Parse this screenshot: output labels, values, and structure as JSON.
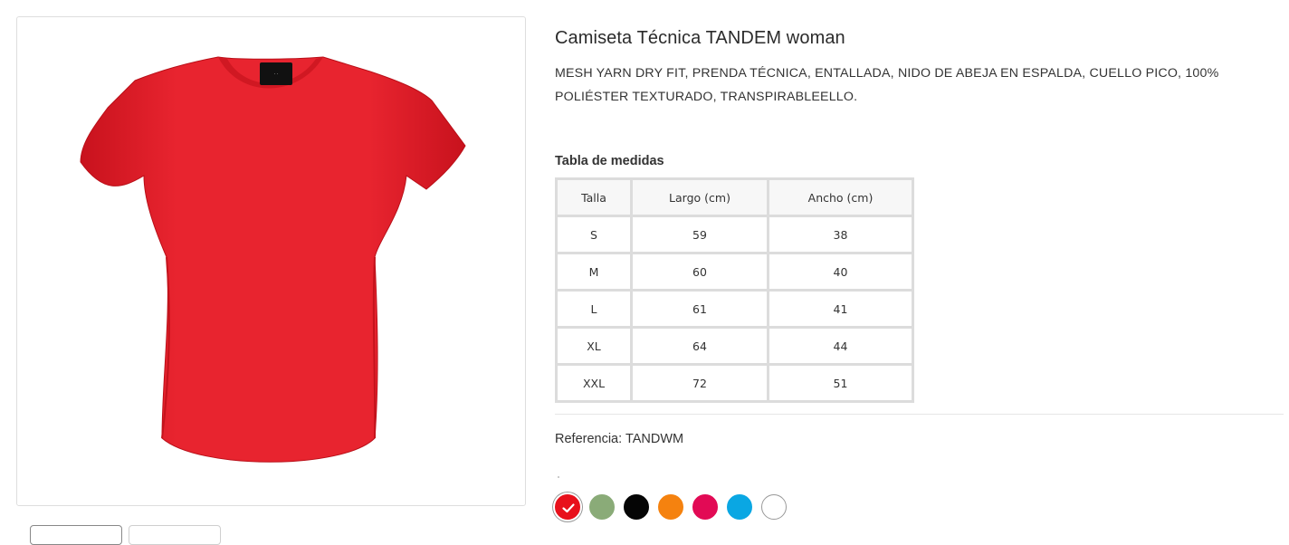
{
  "product": {
    "title": "Camiseta Técnica TANDEM woman",
    "description": "MESH YARN DRY FIT, PRENDA TÉCNICA, ENTALLADA, NIDO DE ABEJA EN ESPALDA, CUELLO PICO, 100% POLIÉSTER TEXTURADO, TRANSPIRABLEELLO.",
    "image_color": "#e8242f",
    "reference_label": "Referencia:",
    "reference_value": "TANDWM"
  },
  "size_table": {
    "heading": "Tabla de medidas",
    "headers": [
      "Talla",
      "Largo (cm)",
      "Ancho (cm)"
    ],
    "rows": [
      [
        "S",
        "59",
        "38"
      ],
      [
        "M",
        "60",
        "40"
      ],
      [
        "L",
        "61",
        "41"
      ],
      [
        "XL",
        "64",
        "44"
      ],
      [
        "XXL",
        "72",
        "51"
      ]
    ]
  },
  "colors": [
    {
      "name": "red",
      "hex": "#e8101b",
      "selected": true
    },
    {
      "name": "sage-green",
      "hex": "#8aab78",
      "selected": false
    },
    {
      "name": "black",
      "hex": "#050505",
      "selected": false
    },
    {
      "name": "orange",
      "hex": "#f5820f",
      "selected": false
    },
    {
      "name": "raspberry",
      "hex": "#e20a55",
      "selected": false
    },
    {
      "name": "sky-blue",
      "hex": "#0aa7e3",
      "selected": false
    },
    {
      "name": "white",
      "hex": "#ffffff",
      "selected": false
    }
  ]
}
